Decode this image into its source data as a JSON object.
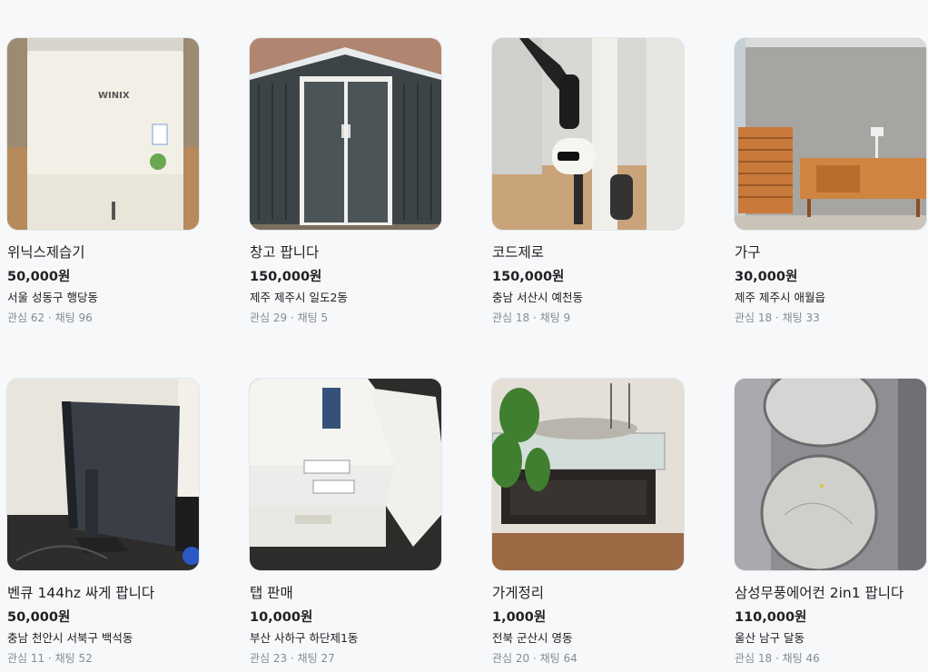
{
  "items": [
    {
      "title": "위닉스제습기",
      "price": "50,000원",
      "region": "서울 성동구 행당동",
      "counts": "관심 62 · 채팅 96",
      "image": "dehumidifier-photo"
    },
    {
      "title": "창고 팝니다",
      "price": "150,000원",
      "region": "제주 제주시 일도2동",
      "counts": "관심 29 · 채팅 5",
      "image": "storage-shed-photo"
    },
    {
      "title": "코드제로",
      "price": "150,000원",
      "region": "충남 서산시 예천동",
      "counts": "관심 18 · 채팅 9",
      "image": "cordless-vacuum-photo"
    },
    {
      "title": "가구",
      "price": "30,000원",
      "region": "제주 제주시 애월읍",
      "counts": "관심 18 · 채팅 33",
      "image": "furniture-photo"
    },
    {
      "title": "벤큐 144hz 싸게 팝니다",
      "price": "50,000원",
      "region": "충남 천안시 서북구 백석동",
      "counts": "관심 11 · 채팅 52",
      "image": "monitor-photo"
    },
    {
      "title": "탭 판매",
      "price": "10,000원",
      "region": "부산 사하구 하단제1동",
      "counts": "관심 23 · 채팅 27",
      "image": "tablet-boxes-photo"
    },
    {
      "title": "가게정리",
      "price": "1,000원",
      "region": "전북 군산시 영동",
      "counts": "관심 20 · 채팅 64",
      "image": "store-display-photo"
    },
    {
      "title": "삼성무풍에어컨 2in1 팝니다",
      "price": "110,000원",
      "region": "울산 남구 달동",
      "counts": "관심 18 · 채팅 46",
      "image": "air-conditioner-photo"
    }
  ],
  "logo_text": "WINIX"
}
